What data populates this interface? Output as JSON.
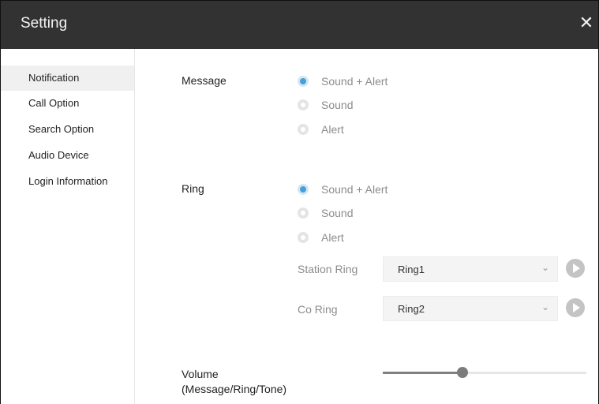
{
  "window": {
    "title": "Setting",
    "close_glyph": "✕"
  },
  "sidebar": {
    "items": [
      {
        "label": "Notification",
        "active": true
      },
      {
        "label": "Call Option"
      },
      {
        "label": "Search Option"
      },
      {
        "label": "Audio Device"
      },
      {
        "label": "Login Information"
      }
    ]
  },
  "message": {
    "label": "Message",
    "options": [
      "Sound + Alert",
      "Sound",
      "Alert"
    ],
    "selected": "Sound + Alert"
  },
  "ring": {
    "label": "Ring",
    "options": [
      "Sound + Alert",
      "Sound",
      "Alert"
    ],
    "selected": "Sound + Alert",
    "station_ring": {
      "label": "Station Ring",
      "value": "Ring1"
    },
    "co_ring": {
      "label": "Co Ring",
      "value": "Ring2"
    }
  },
  "volume": {
    "label_line1": "Volume",
    "label_line2": "(Message/Ring/Tone)",
    "level": 0.39
  },
  "icons": {
    "close": "close-icon",
    "radio": "radio-button-icon",
    "chevron": "chevron-down-icon",
    "play": "play-icon"
  },
  "colors": {
    "titlebar": "#323232",
    "radio_selected": "#4a9fd8",
    "slider_fill": "#808080"
  }
}
